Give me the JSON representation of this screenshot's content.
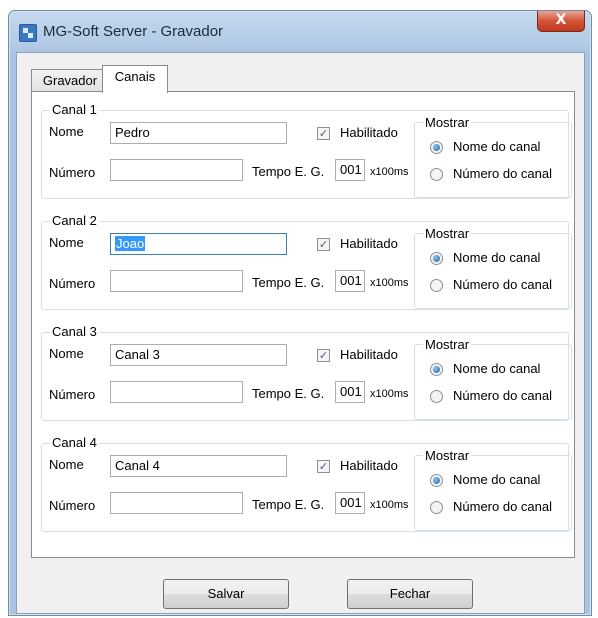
{
  "window": {
    "title": "MG-Soft Server - Gravador",
    "close_glyph": "X"
  },
  "tabs": [
    {
      "label": "Gravador"
    },
    {
      "label": "Canais"
    }
  ],
  "channels": [
    {
      "caption": "Canal 1",
      "nome_label": "Nome",
      "nome_value": "Pedro",
      "numero_label": "Número",
      "numero_value": "",
      "habilitado_label": "Habilitado",
      "tempo_label": "Tempo E. G.",
      "tempo_value": "001",
      "tempo_unit": "x100ms",
      "mostrar_label": "Mostrar",
      "opt_nome": "Nome do canal",
      "opt_numero": "Número do canal"
    },
    {
      "caption": "Canal 2",
      "nome_label": "Nome",
      "nome_value": "Joao",
      "numero_label": "Número",
      "numero_value": "",
      "habilitado_label": "Habilitado",
      "tempo_label": "Tempo E. G.",
      "tempo_value": "001",
      "tempo_unit": "x100ms",
      "mostrar_label": "Mostrar",
      "opt_nome": "Nome do canal",
      "opt_numero": "Número do canal"
    },
    {
      "caption": "Canal 3",
      "nome_label": "Nome",
      "nome_value": "Canal 3",
      "numero_label": "Número",
      "numero_value": "",
      "habilitado_label": "Habilitado",
      "tempo_label": "Tempo E. G.",
      "tempo_value": "001",
      "tempo_unit": "x100ms",
      "mostrar_label": "Mostrar",
      "opt_nome": "Nome do canal",
      "opt_numero": "Número do canal"
    },
    {
      "caption": "Canal 4",
      "nome_label": "Nome",
      "nome_value": "Canal 4",
      "numero_label": "Número",
      "numero_value": "",
      "habilitado_label": "Habilitado",
      "tempo_label": "Tempo E. G.",
      "tempo_value": "001",
      "tempo_unit": "x100ms",
      "mostrar_label": "Mostrar",
      "opt_nome": "Nome do canal",
      "opt_numero": "Número do canal"
    }
  ],
  "buttons": {
    "save_label": "Salvar",
    "close_label": "Fechar"
  }
}
